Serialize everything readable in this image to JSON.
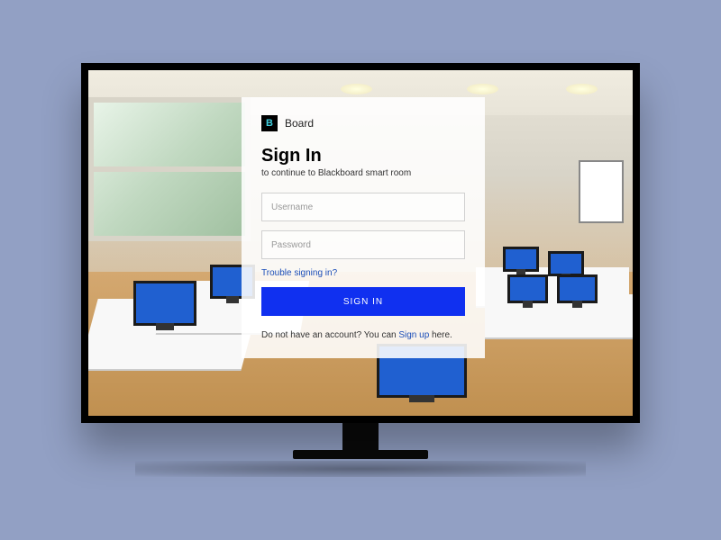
{
  "brand": {
    "icon_letter": "B",
    "name": "Board"
  },
  "form": {
    "title": "Sign In",
    "subtitle": "to continue to Blackboard smart room",
    "username_placeholder": "Username",
    "password_placeholder": "Password",
    "trouble_link": "Trouble signing in?",
    "submit_label": "SIGN IN",
    "signup_prefix": "Do not have an account? You can ",
    "signup_link": "Sign up",
    "signup_suffix": " here."
  }
}
